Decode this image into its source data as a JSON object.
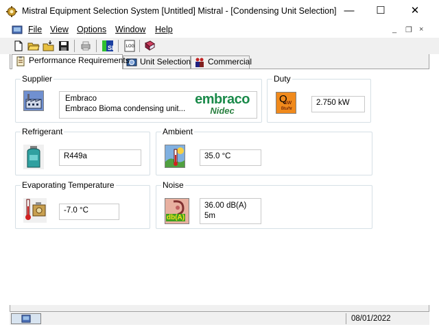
{
  "window": {
    "title": "Mistral Equipment Selection System [Untitled] Mistral - [Condensing Unit Selection]",
    "controls": {
      "minimize": "—",
      "maximize": "☐",
      "close": "✕"
    }
  },
  "menu": {
    "items": [
      "File",
      "View",
      "Options",
      "Window",
      "Help"
    ],
    "mdi": {
      "minimize": "_",
      "restore": "❐",
      "close": "×"
    }
  },
  "toolbar": {
    "buttons": [
      "new-document-icon",
      "open-folder-icon",
      "open-file-icon",
      "save-icon",
      "print-icon",
      "si-units-icon",
      "log-icon",
      "book-icon"
    ]
  },
  "tabs": [
    {
      "label": "Performance Requirements",
      "active": true
    },
    {
      "label": "Unit Selection",
      "active": false
    },
    {
      "label": "Commercial",
      "active": false
    }
  ],
  "supplier": {
    "label": "Supplier",
    "name": "Embraco",
    "description": "Embraco Bioma condensing unit...",
    "logo_text": "embraco",
    "logo_subtext": "Nidec"
  },
  "duty": {
    "label": "Duty",
    "icon_text_q": "Q",
    "icon_text_kw": "kW",
    "icon_text_btu": "Btu/hr",
    "value": "2.750 kW"
  },
  "refrigerant": {
    "label": "Refrigerant",
    "value": "R449a"
  },
  "ambient": {
    "label": "Ambient",
    "value": "35.0 °C"
  },
  "evaporating": {
    "label": "Evaporating Temperature",
    "value": "-7.0 °C"
  },
  "noise": {
    "label": "Noise",
    "icon_text": "db(A)",
    "value": "36.00 dB(A)",
    "distance": "5m"
  },
  "status": {
    "date": "08/01/2022"
  },
  "colors": {
    "logo_green": "#1a8a4a",
    "logo_blue": "#2a6db3",
    "duty_orange": "#f08a1c"
  }
}
